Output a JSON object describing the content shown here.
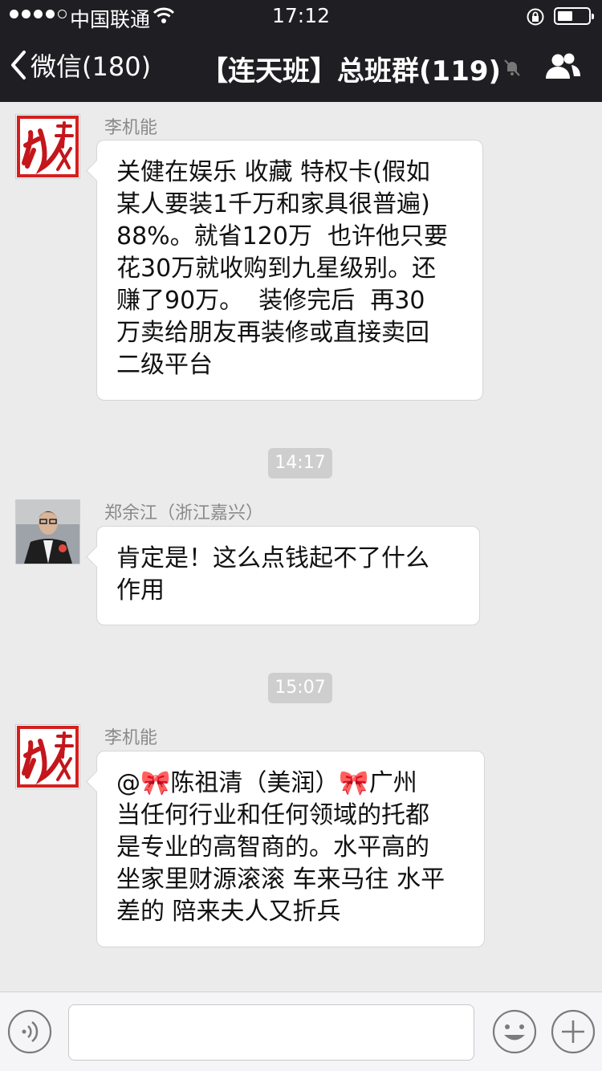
{
  "status_bar": {
    "carrier": "中国联通",
    "time": "17:12"
  },
  "nav": {
    "back_label": "微信(180)",
    "title": "【连天班】总班群(119)"
  },
  "messages": [
    {
      "sender": "李机能",
      "text": "关健在娱乐 收藏 特权卡(假如\n某人要装1千万和家具很普遍)\n88%。就省120万  也许他只要\n花30万就收购到九星级别。还\n赚了90万。  装修完后  再30\n万卖给朋友再装修或直接卖回\n二级平台"
    },
    {
      "timestamp": "14:17"
    },
    {
      "sender": "郑余江（浙江嘉兴）",
      "text": "肯定是！这么点钱起不了什么\n作用"
    },
    {
      "timestamp": "15:07"
    },
    {
      "sender": "李机能",
      "text": "@🎀陈祖清（美润）🎀广州\n当任何行业和任何领域的托都\n是专业的高智商的。水平高的\n坐家里财源滚滚 车来马往 水平\n差的 陪来夫人又折兵"
    }
  ]
}
